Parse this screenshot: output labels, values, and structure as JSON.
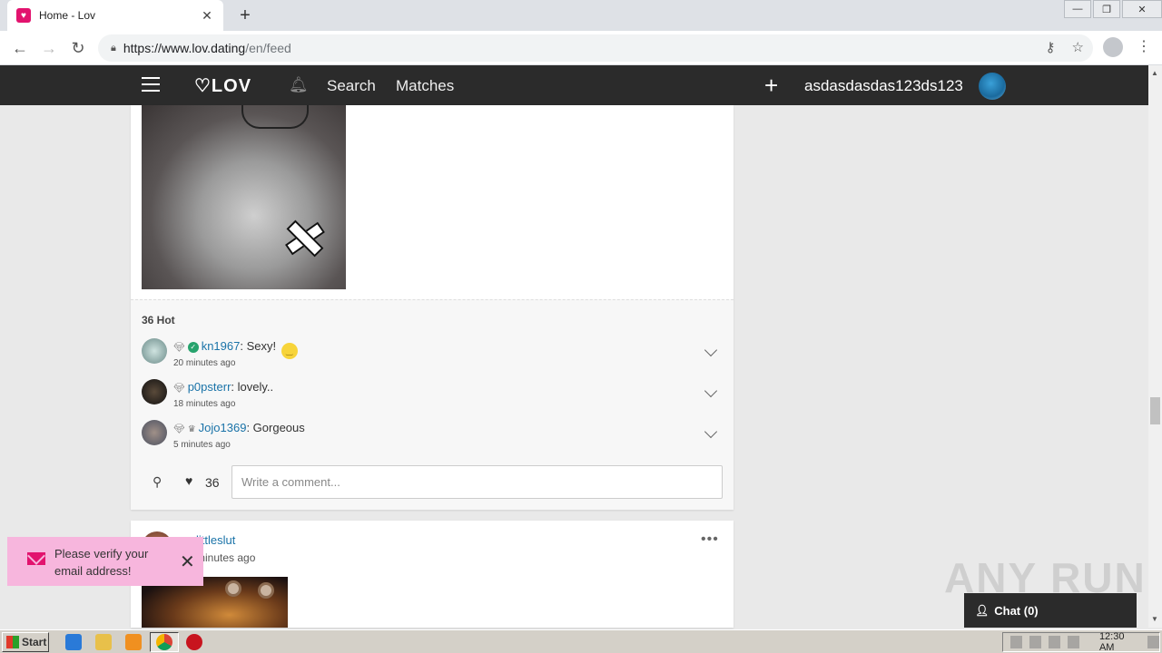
{
  "browser": {
    "tab_title": "Home - Lov",
    "tab_close": "✕",
    "new_tab": "+",
    "url_host": "https://www.lov.dating",
    "url_path": "/en/feed",
    "window_controls": [
      "—",
      "❐",
      "✕"
    ]
  },
  "header": {
    "logo": "♡LOV",
    "nav": [
      "Search",
      "Matches"
    ],
    "add": "+",
    "username": "asdasdasdas123ds123"
  },
  "post": {
    "hot_count": "36 Hot",
    "comments": [
      {
        "user": "kn1967",
        "text": ": Sexy!",
        "time": "20 minutes ago",
        "verified": true,
        "emoji": true
      },
      {
        "user": "p0psterr",
        "text": ": lovely..",
        "time": "18 minutes ago",
        "verified": false,
        "emoji": false
      },
      {
        "user": "Jojo1369",
        "text": ": Gorgeous",
        "time": "5 minutes ago",
        "verified": false,
        "emoji": false
      }
    ],
    "likes": "36",
    "comment_placeholder": "Write a comment..."
  },
  "post2": {
    "user": "littleslut",
    "time": "minutes ago",
    "more": "•••"
  },
  "toast": {
    "message": "Please verify your email address!",
    "close": "✕"
  },
  "watermark": "ANY RUN",
  "chat": {
    "label": "Chat (0)"
  },
  "taskbar": {
    "start": "Start",
    "clock": "12:30 AM"
  },
  "colors": {
    "brand_pink": "#e2136e",
    "header_bg": "#2b2b2b",
    "link": "#1a73a8",
    "toast_bg": "#f7b6dd"
  },
  "icons": [
    "lov-heart-icon",
    "bell-icon",
    "plus-icon",
    "hamburger-icon",
    "key-icon",
    "star-icon",
    "mail-icon",
    "pin-icon",
    "heart-icon",
    "chevron-down-icon",
    "more-icon",
    "chat-user-icon"
  ]
}
